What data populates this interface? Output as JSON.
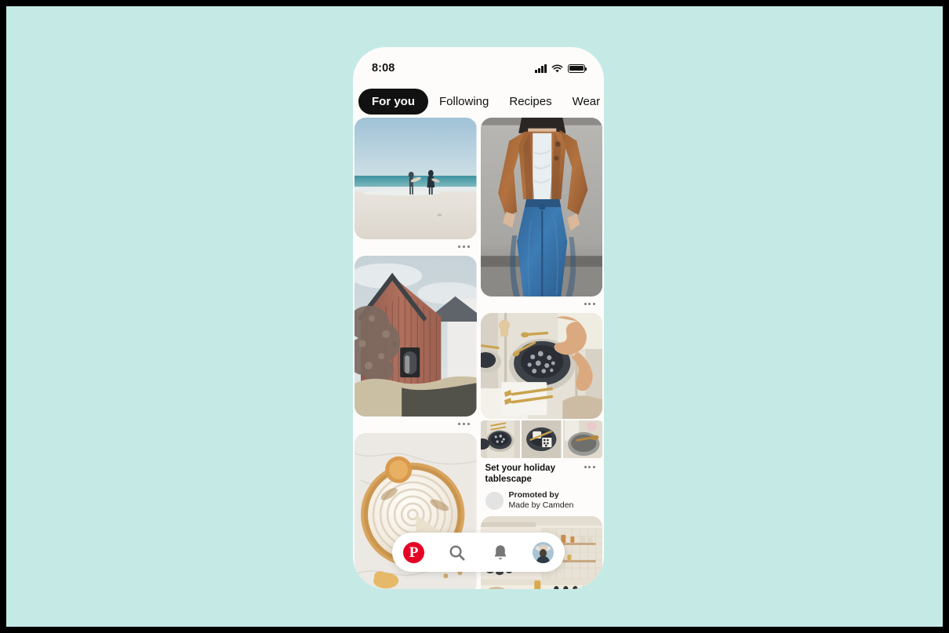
{
  "background_color": "#c5eae6",
  "frame_color": "#000000",
  "app": {
    "name": "Pinterest",
    "accent_color": "#e60023"
  },
  "status_bar": {
    "time": "8:08",
    "icons": [
      "signal-bars-icon",
      "wifi-icon",
      "battery-icon"
    ]
  },
  "tabs": [
    {
      "label": "For you",
      "active": true
    },
    {
      "label": "Following",
      "active": false
    },
    {
      "label": "Recipes",
      "active": false
    },
    {
      "label": "Wear",
      "active": false
    }
  ],
  "feed": {
    "left_column": [
      {
        "id": "pin-beach",
        "alt": "Two surfers walking on a beach toward the ocean",
        "overflow": "•••"
      },
      {
        "id": "pin-barn",
        "alt": "Red vertical-plank barn with dark window and flowering tree",
        "overflow": "•••"
      },
      {
        "id": "pin-tart",
        "alt": "Meringue lemon tart on marble surface",
        "overflow": "•••"
      }
    ],
    "right_column": [
      {
        "id": "pin-outfit",
        "alt": "Woman wearing brown leather jacket, white tank top and blue jeans",
        "overflow": "•••"
      },
      {
        "id": "pin-tablescape",
        "alt": "Hands setting a holiday table with gold cutlery and dark plates",
        "title": "Set your holiday tablescape",
        "promoted_label": "Promoted by",
        "advertiser": "Made by Camden",
        "overflow": "•••",
        "thumbnails": [
          {
            "alt": "Dark speckled plate with gold spoons"
          },
          {
            "alt": "Napkin and chopsticks on slate plate"
          },
          {
            "alt": "Grey bowl with wooden spoon"
          }
        ]
      },
      {
        "id": "pin-kitchen",
        "alt": "Bright kitchen with open shelving and tiled backsplash",
        "overflow": ""
      }
    ]
  },
  "bottom_nav": [
    {
      "id": "home",
      "icon": "pinterest-logo-icon",
      "label": "Home"
    },
    {
      "id": "search",
      "icon": "search-icon",
      "label": "Search"
    },
    {
      "id": "notifications",
      "icon": "bell-icon",
      "label": "Notifications"
    },
    {
      "id": "profile",
      "icon": "avatar-icon",
      "label": "Profile"
    }
  ]
}
